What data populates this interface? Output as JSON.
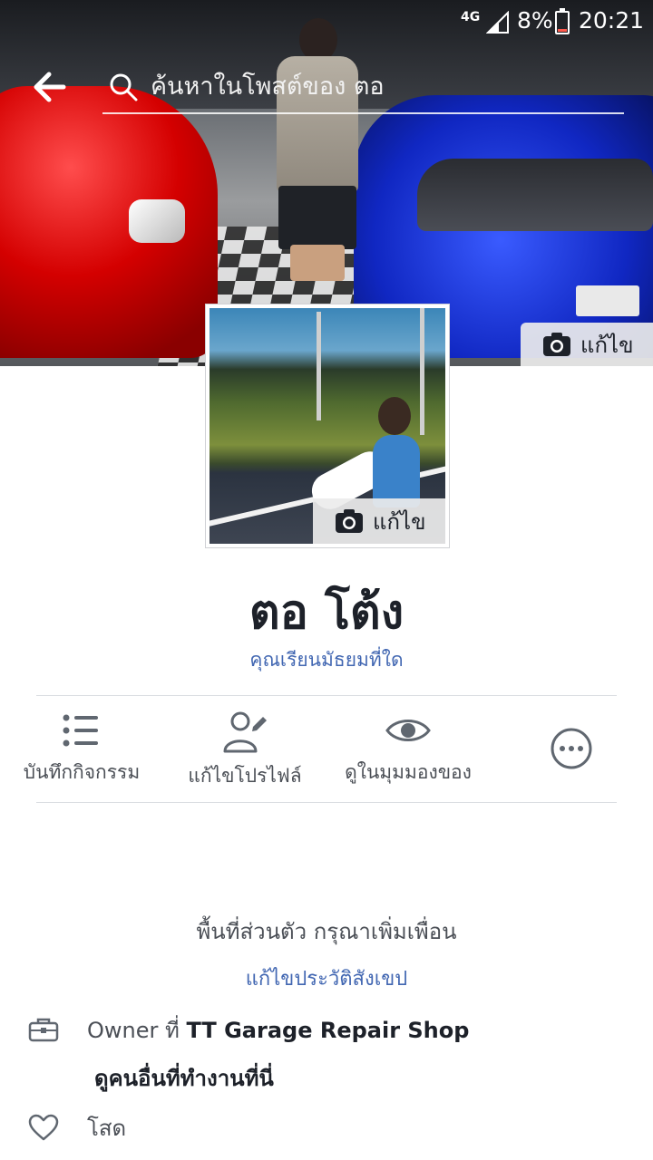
{
  "status_bar": {
    "network": "4G",
    "battery": "8%",
    "time": "20:21"
  },
  "search": {
    "placeholder": "ค้นหาในโพสต์ของ ตอ"
  },
  "cover": {
    "edit_label": "แก้ไข"
  },
  "profile_picture": {
    "edit_label": "แก้ไข"
  },
  "profile": {
    "name": "ตอ โต้ง",
    "school_prompt": "คุณเรียนมัธยมที่ใด"
  },
  "actions": [
    {
      "label": "บันทึกกิจกรรม",
      "icon": "activity-log-icon"
    },
    {
      "label": "แก้ไขโปรไฟล์",
      "icon": "edit-profile-icon"
    },
    {
      "label": "ดูในมุมมองของ",
      "icon": "eye-icon"
    },
    {
      "label": "",
      "icon": "more-icon"
    }
  ],
  "intro": {
    "privacy_text": "พื้นที่ส่วนตัว กรุณาเพิ่มเพื่อน",
    "edit_bio": "แก้ไขประวัติสังเขป",
    "work": {
      "prefix": "Owner ที่ ",
      "workplace": "TT Garage Repair Shop",
      "see_coworkers": "ดูคนอื่นที่ทำงานที่นี่"
    },
    "relationship": "โสด"
  },
  "colors": {
    "link": "#4267b2",
    "text": "#1d2129",
    "secondary_text": "#4b4f56",
    "icon": "#606770"
  }
}
